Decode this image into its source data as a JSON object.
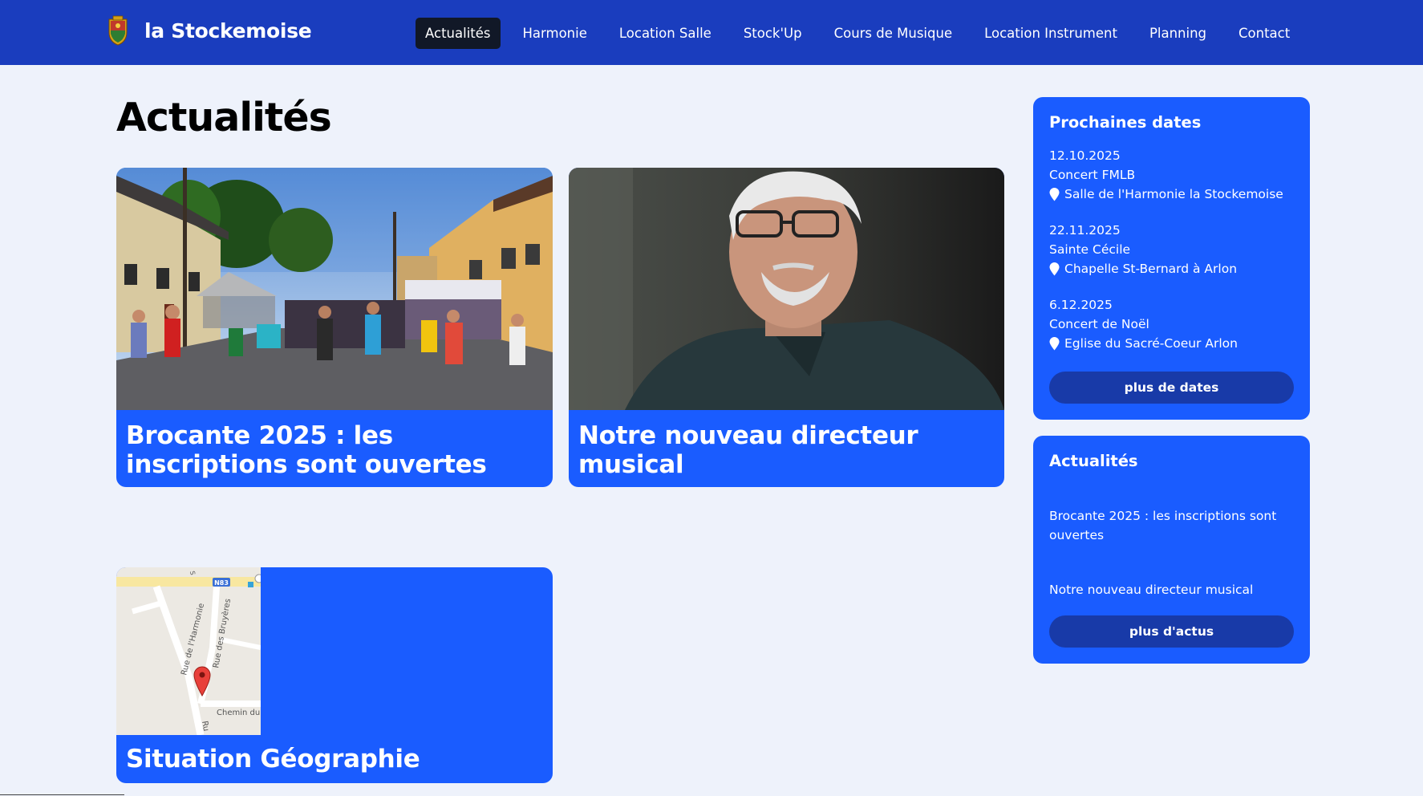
{
  "brand": {
    "name": "la Stockemoise"
  },
  "nav": {
    "items": [
      {
        "label": "Actualités",
        "active": true
      },
      {
        "label": "Harmonie",
        "active": false
      },
      {
        "label": "Location Salle",
        "active": false
      },
      {
        "label": "Stock'Up",
        "active": false
      },
      {
        "label": "Cours de Musique",
        "active": false
      },
      {
        "label": "Location Instrument",
        "active": false
      },
      {
        "label": "Planning",
        "active": false
      },
      {
        "label": "Contact",
        "active": false
      }
    ]
  },
  "main": {
    "title": "Actualités",
    "cards": [
      {
        "title": "Brocante 2025 : les inscriptions sont ouvertes"
      },
      {
        "title": "Notre nouveau directeur musical"
      },
      {
        "title": "Situation Géographie"
      }
    ],
    "map": {
      "road_badge": "N83",
      "streets": [
        "Rue de l'Harmonie",
        "Rue des Bruyères",
        "Chemin du",
        "Ru",
        "S"
      ]
    }
  },
  "sidebar": {
    "dates": {
      "title": "Prochaines dates",
      "events": [
        {
          "date": "12.10.2025",
          "name": "Concert FMLB",
          "place": "Salle de l'Harmonie la Stockemoise"
        },
        {
          "date": "22.11.2025",
          "name": "Sainte Cécile",
          "place": "Chapelle St-Bernard à Arlon"
        },
        {
          "date": "6.12.2025",
          "name": "Concert de Noël",
          "place": "Eglise du Sacré-Coeur Arlon"
        }
      ],
      "button": "plus de dates"
    },
    "news": {
      "title": "Actualités",
      "items": [
        "Brocante 2025 : les inscriptions sont ouvertes",
        "Notre nouveau directeur musical"
      ],
      "button": "plus d'actus"
    }
  },
  "colors": {
    "navbar": "#1a3dbe",
    "card": "#1a5cff",
    "button": "#183aa8",
    "background": "#eef2fb"
  }
}
